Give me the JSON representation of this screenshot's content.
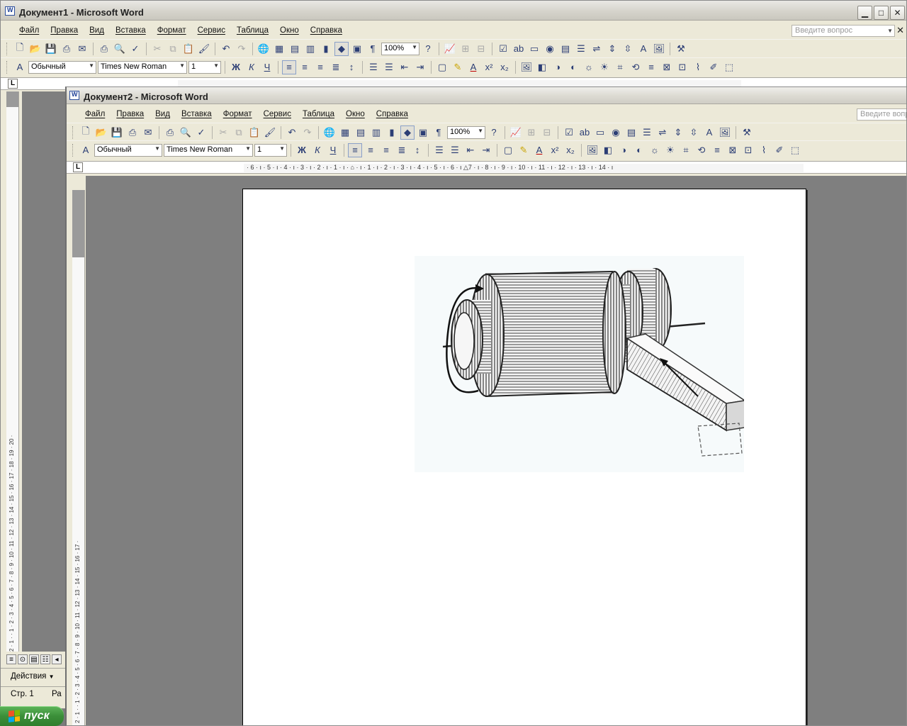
{
  "window1": {
    "title": "Документ1 - Microsoft Word",
    "menu": [
      "Файл",
      "Правка",
      "Вид",
      "Вставка",
      "Формат",
      "Сервис",
      "Таблица",
      "Окно",
      "Справка"
    ],
    "ask_placeholder": "Введите вопрос",
    "zoom": "100%",
    "style": "Обычный",
    "font": "Times New Roman",
    "size": "1",
    "vertical_ruler": "2 · 1 · · 1 · 2 · 3 · 4 · 5 · 6 · 7 · 8 · 9 · 10 · 11 · 12 · 13 · 14 · 15 · 16 · 17 · 18 · 19 · 20 ·",
    "drawing_actions": "Действия",
    "status_page": "Стр. 1",
    "status_extra": "Ра"
  },
  "window2": {
    "title": "Документ2 - Microsoft Word",
    "menu": [
      "Файл",
      "Правка",
      "Вид",
      "Вставка",
      "Формат",
      "Сервис",
      "Таблица",
      "Окно",
      "Справка"
    ],
    "ask_placeholder": "Введите вопр",
    "zoom": "100%",
    "style": "Обычный",
    "font": "Times New Roman",
    "size": "1",
    "ruler_text": "· 6 · ı · 5 · ı · 4 · ı · 3 · ı · 2 · ı · 1 · ı · ⌂ · ı · 1 · ı · 2 · ı · 3 · ı · 4 · ı · 5 · ı · 6 · ı △7 · ı · 8 · ı · 9 · ı · 10 · ı · 11 · ı · 12 · ı · 13 · ı · 14 · ı",
    "vertical_ruler": "2 · 1 · · 1 · 2 · 3 · 4 · 5 · 6 · 7 · 8 · 9 · 10 · 11 · 12 · 13 · 14 · 15 · 16 · 17 ·"
  },
  "taskbar": {
    "start_label": "пуск"
  }
}
